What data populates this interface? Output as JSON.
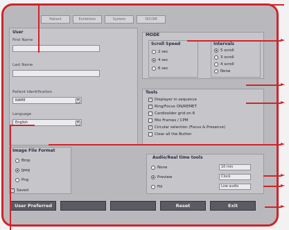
{
  "tabs": [
    "Patient",
    "Exhibition",
    "System",
    "DICOM"
  ],
  "user": {
    "title": "User",
    "first_name_label": "First Name",
    "first_name_value": "",
    "last_name_label": "Last Name",
    "last_name_value": "",
    "patient_id_label": "Patient Identification",
    "patient_id_value": "NAME",
    "language_label": "Language",
    "language_value": "English"
  },
  "mode": {
    "title": "MODE",
    "scroll_speed": {
      "title": "Scroll Speed",
      "options": [
        "2 sec",
        "4 sec",
        "6 sec"
      ],
      "selected": 1
    },
    "intervals": {
      "title": "Intervals",
      "options": [
        "5 scroll",
        "3 scroll",
        "4 scroll",
        "None"
      ],
      "selected": 0
    }
  },
  "tools": {
    "title": "Tools",
    "items": [
      {
        "label": "Displayer in sequence",
        "checked": true
      },
      {
        "label": "Ring/Focus ON/REMET",
        "checked": true
      },
      {
        "label": "Cardioolder grid on 6",
        "checked": false
      },
      {
        "label": "Mix Frames / CPM",
        "checked": false
      },
      {
        "label": "Circular selection (Focus & Presence)",
        "checked": true
      },
      {
        "label": "Clear all the Button",
        "checked": false
      }
    ]
  },
  "image_format": {
    "title": "Image File Format",
    "options": [
      "Bmp",
      "Jpeg",
      "Png"
    ],
    "selected": 1,
    "save_label": "Saved",
    "save_checked": true
  },
  "audio": {
    "title": "Audio/Real time tools",
    "options": [
      "None",
      "Preview",
      "Fill"
    ],
    "selected": 1,
    "selects": [
      "10 min",
      "Clock",
      "Low audio"
    ]
  },
  "bottom_buttons": [
    "User Preferred",
    "",
    "",
    "Reset",
    "Exit"
  ]
}
